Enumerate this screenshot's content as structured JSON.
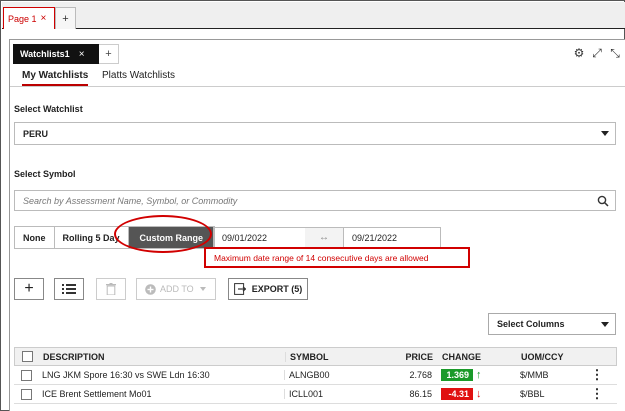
{
  "top_tabs": {
    "page_tab": "Page 1",
    "close": "×",
    "add": "+"
  },
  "panel": {
    "watchlist_tab": "Watchlists1",
    "close": "×",
    "add": "+",
    "subtabs": {
      "active": "My Watchlists",
      "other": "Platts Watchlists"
    }
  },
  "watchlist": {
    "label": "Select Watchlist",
    "selected": "PERU"
  },
  "symbol": {
    "label": "Select Symbol",
    "placeholder": "Search by Assessment Name, Symbol, or Commodity"
  },
  "range": {
    "buttons": [
      "None",
      "Rolling 5 Day",
      "Custom Range"
    ],
    "start_date": "09/01/2022",
    "separator": "↔",
    "end_date": "09/21/2022",
    "error": "Maximum date range of 14 consecutive days are allowed"
  },
  "toolbar": {
    "add": "+",
    "add_to": "ADD TO",
    "export": "EXPORT (5)"
  },
  "columns_select": "Select Columns",
  "table": {
    "headers": {
      "description": "DESCRIPTION",
      "symbol": "SYMBOL",
      "price": "PRICE",
      "change": "CHANGE",
      "uom": "UOM/CCY"
    },
    "rows": [
      {
        "description": "LNG JKM Spore 16:30 vs SWE Ldn 16:30",
        "symbol": "ALNGB00",
        "price": "2.768",
        "change": "1.369",
        "arrow": "↑",
        "uom": "$/MMB",
        "menu": "⋮"
      },
      {
        "description": "ICE Brent Settlement Mo01",
        "symbol": "ICLL001",
        "price": "86.15",
        "change": "-4.31",
        "arrow": "↓",
        "uom": "$/BBL",
        "menu": "⋮"
      }
    ]
  },
  "colors": {
    "accent_red": "#d10000",
    "up_green": "#1a9a2a",
    "down_red": "#e01010"
  }
}
